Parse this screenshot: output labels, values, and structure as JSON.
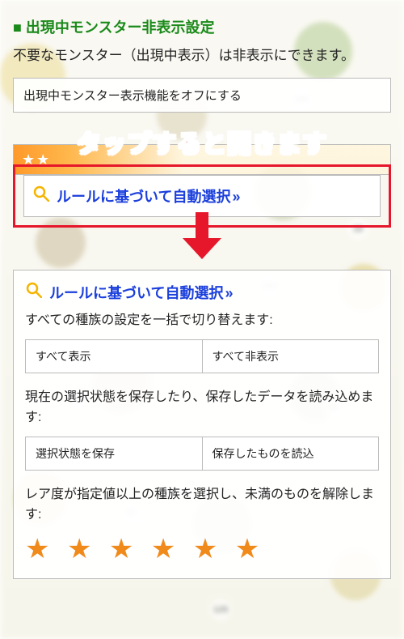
{
  "section": {
    "title": "出現中モンスター非表示設定",
    "desc": "不要なモンスター（出現中表示）は非表示にできます。",
    "toggle_label": "出現中モンスター表示機能をオフにする"
  },
  "overlay": "タップすると開きます",
  "rule_select": {
    "icon": "search-icon",
    "label": "ルールに基づいて自動選択",
    "chev": " »"
  },
  "panel": {
    "bulk_text": "すべての種族の設定を一括で切り替えます:",
    "bulk_show": "すべて表示",
    "bulk_hide": "すべて非表示",
    "save_text": "現在の選択状態を保存したり、保存したデータを読み込めます:",
    "save_btn": "選択状態を保存",
    "load_btn": "保存したものを読込",
    "rarity_text": "レア度が指定値以上の種族を選択し、未満のものを解除します:",
    "stars": [
      "★",
      "★",
      "★",
      "★",
      "★",
      "★"
    ]
  },
  "band_stars": "★★"
}
